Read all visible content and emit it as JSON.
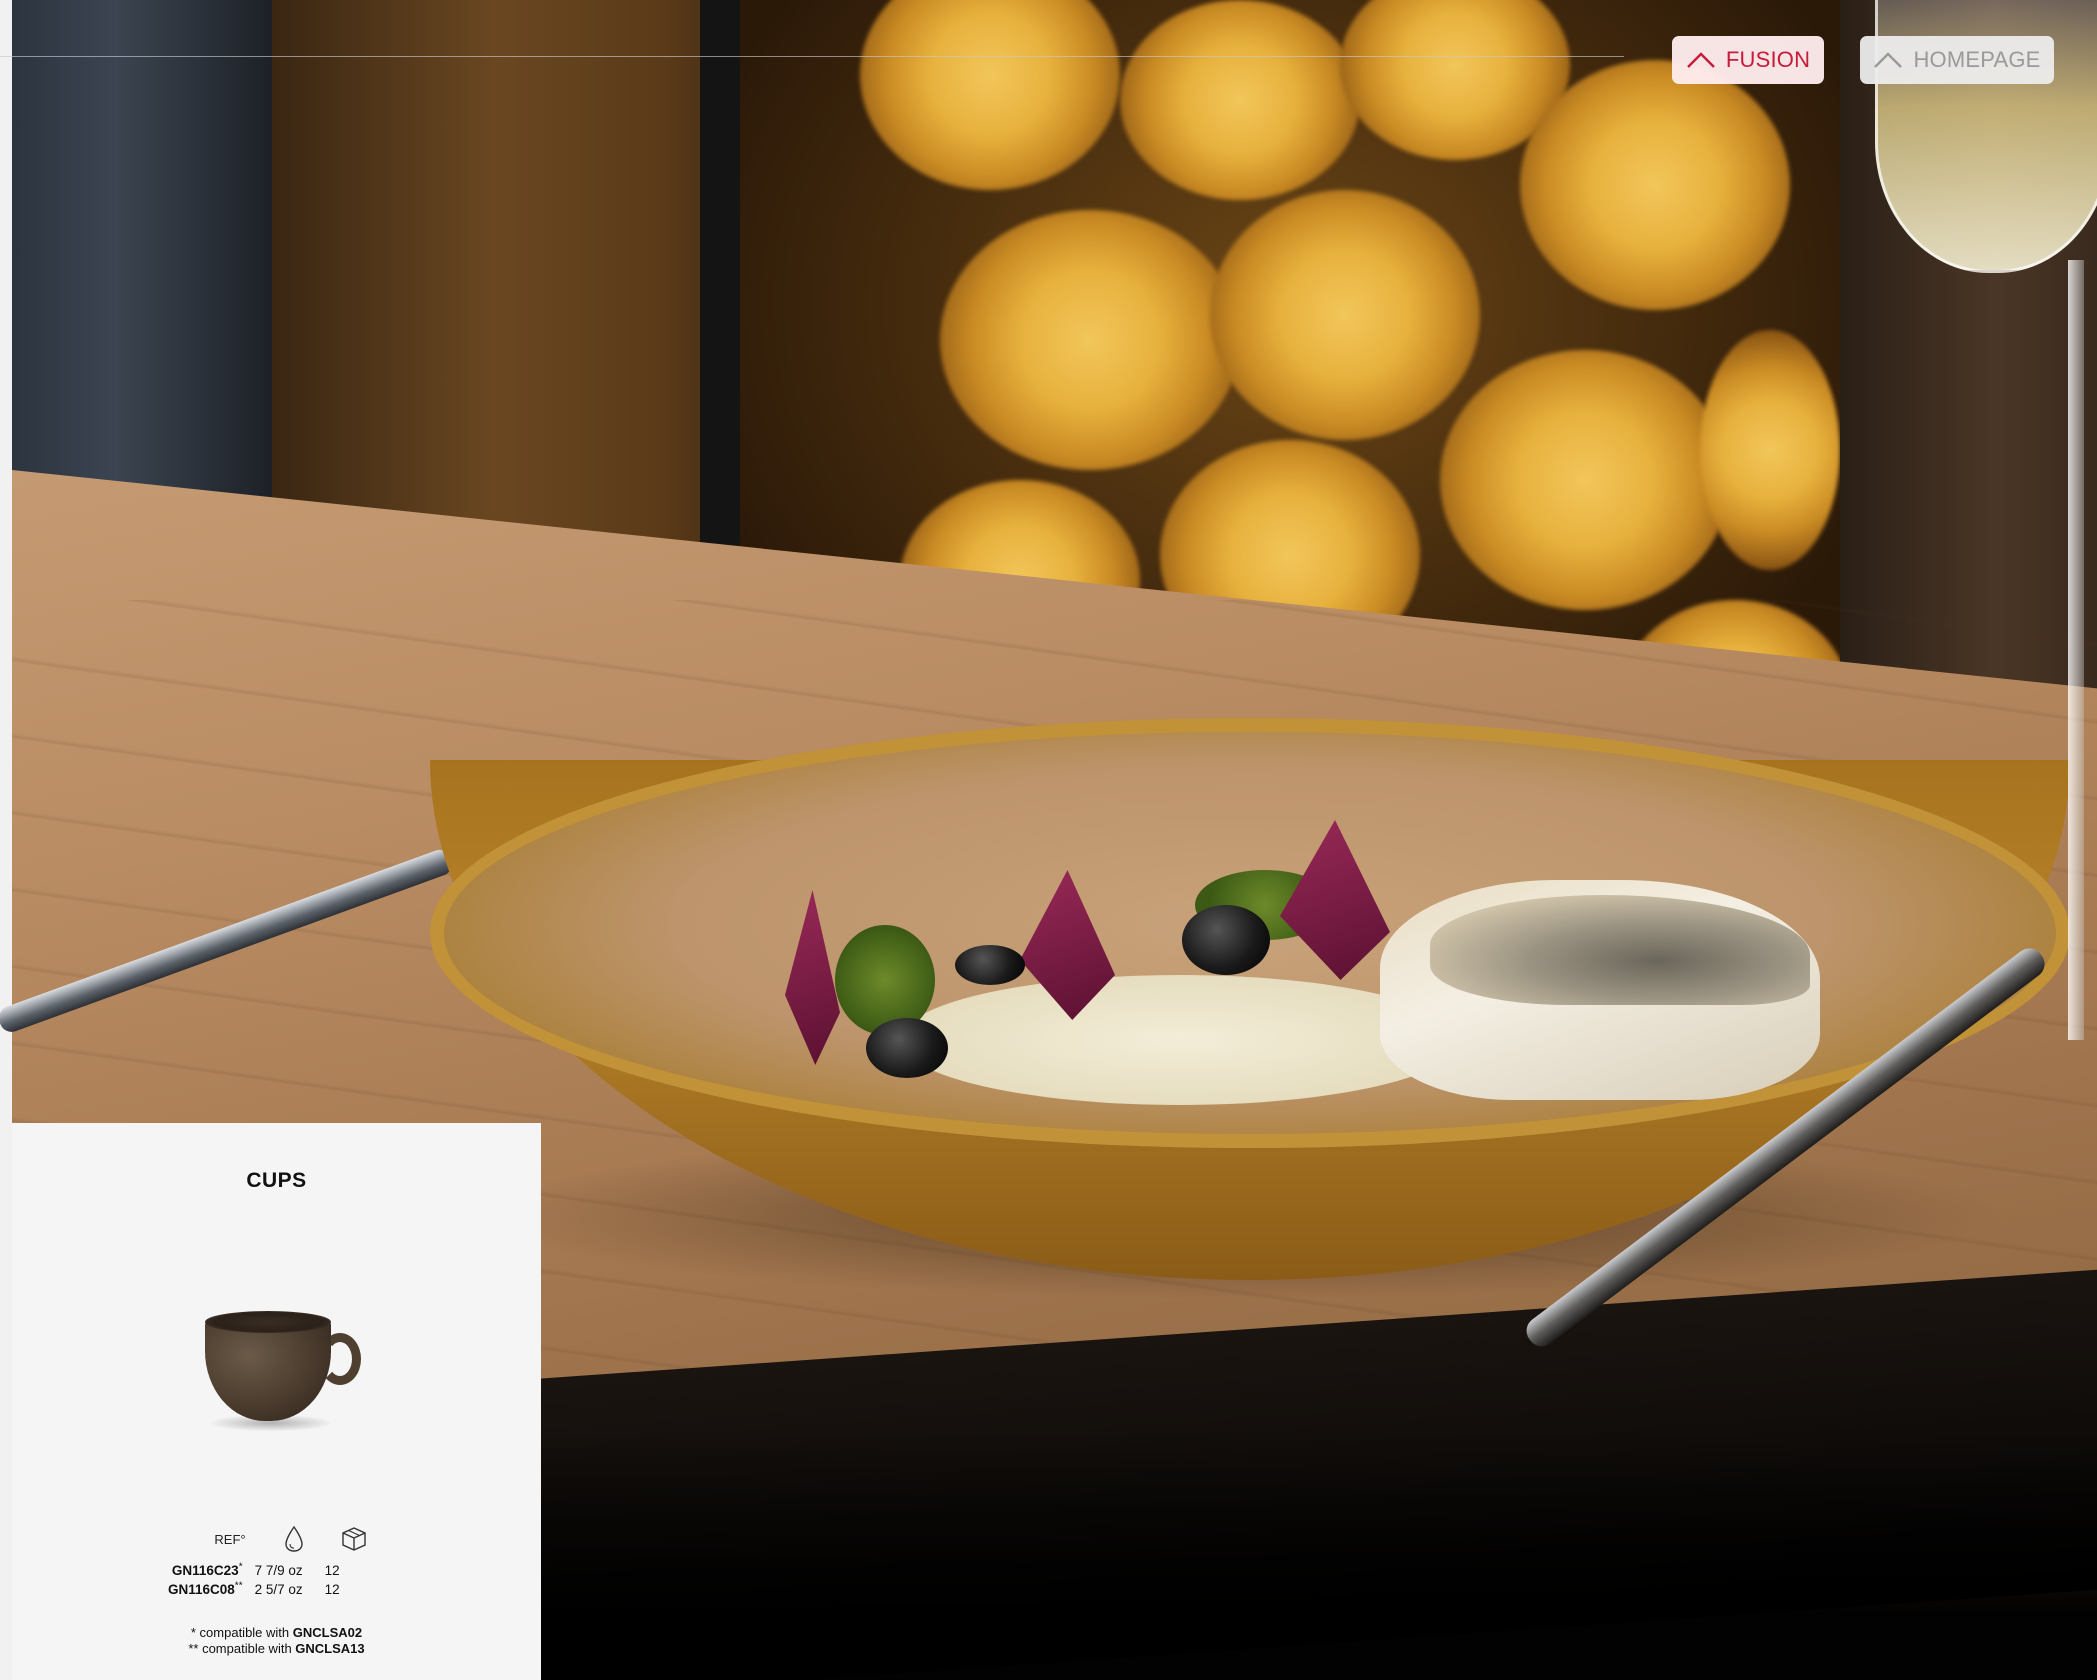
{
  "nav": {
    "fusion_label": "FUSION",
    "homepage_label": "HOMEPAGE",
    "fusion_color": "#c61c3a",
    "homepage_color": "#9a9a9a",
    "icon": "chevron-up-icon"
  },
  "card": {
    "title": "CUPS",
    "ref_header": "REF°",
    "capacity_icon": "drop-icon",
    "pack_icon": "box-icon",
    "rows": [
      {
        "ref": "GN116C23",
        "mark": "*",
        "capacity": "7 7/9 oz",
        "qty": "12"
      },
      {
        "ref": "GN116C08",
        "mark": "**",
        "capacity": "2 5/7 oz",
        "qty": "12"
      }
    ],
    "notes": [
      {
        "prefix": "* compatible with ",
        "ref": "GNCLSA02"
      },
      {
        "prefix": "** compatible with ",
        "ref": "GNCLSA13"
      }
    ]
  }
}
